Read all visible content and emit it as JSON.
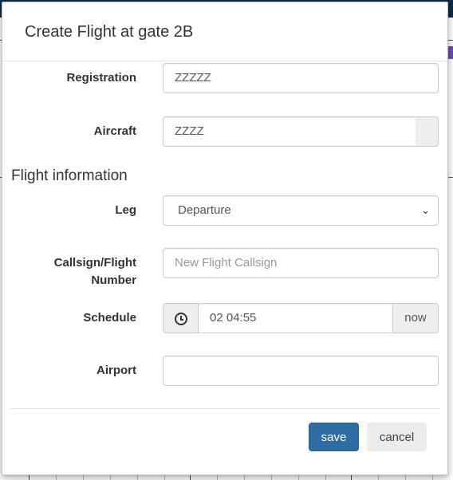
{
  "modal": {
    "title": "Create Flight at gate 2B"
  },
  "form": {
    "registration": {
      "label": "Registration",
      "value": "ZZZZZ"
    },
    "aircraft": {
      "label": "Aircraft",
      "value": "ZZZZ"
    },
    "section_title": "Flight information",
    "leg": {
      "label": "Leg",
      "selected": "Departure"
    },
    "callsign": {
      "label_line1": "Callsign/Flight",
      "label_line2": "Number",
      "placeholder": "New Flight Callsign",
      "value": ""
    },
    "schedule": {
      "label": "Schedule",
      "value": "02 04:55",
      "now_label": "now",
      "icon": "clock-icon"
    },
    "airport": {
      "label": "Airport",
      "value": ""
    }
  },
  "footer": {
    "save_label": "save",
    "cancel_label": "cancel"
  },
  "colors": {
    "primary": "#2e6da4",
    "background_header": "#0d2a4a"
  }
}
